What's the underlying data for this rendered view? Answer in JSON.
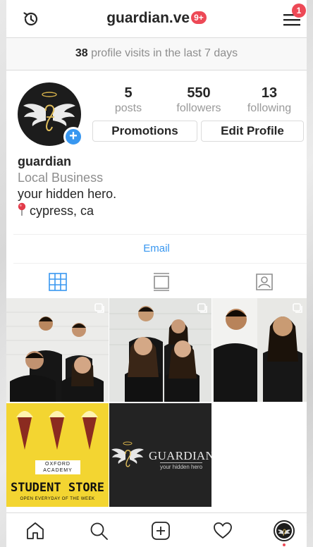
{
  "header": {
    "username": "guardian.ve",
    "notif_count": "9+",
    "menu_badge": "1",
    "icons": [
      "history-icon",
      "menu-icon"
    ]
  },
  "visits": {
    "count": "38",
    "text": " profile visits in the last 7 days"
  },
  "stats": [
    {
      "value": "5",
      "label": "posts"
    },
    {
      "value": "550",
      "label": "followers"
    },
    {
      "value": "13",
      "label": "following"
    }
  ],
  "buttons": {
    "promotions": "Promotions",
    "edit_profile": "Edit Profile",
    "email": "Email"
  },
  "bio": {
    "name": "guardian",
    "category": "Local Business",
    "tagline": "your hidden hero.",
    "location": "cypress, ca"
  },
  "posts": {
    "post4": {
      "brand_line1": "OXFORD",
      "brand_line2": "ACADEMY",
      "headline": "STUDENT STORE",
      "footer": "OPEN EVERYDAY OF THE WEEK"
    },
    "post5": {
      "brand": "GUARDIAN",
      "tagline": "your hidden hero"
    }
  },
  "colors": {
    "accent": "#3897f0",
    "badge": "#ed4956",
    "post4_bg": "#f3d531"
  },
  "bottom_nav": [
    "home-icon",
    "search-icon",
    "new-post-icon",
    "activity-icon",
    "profile-icon"
  ]
}
